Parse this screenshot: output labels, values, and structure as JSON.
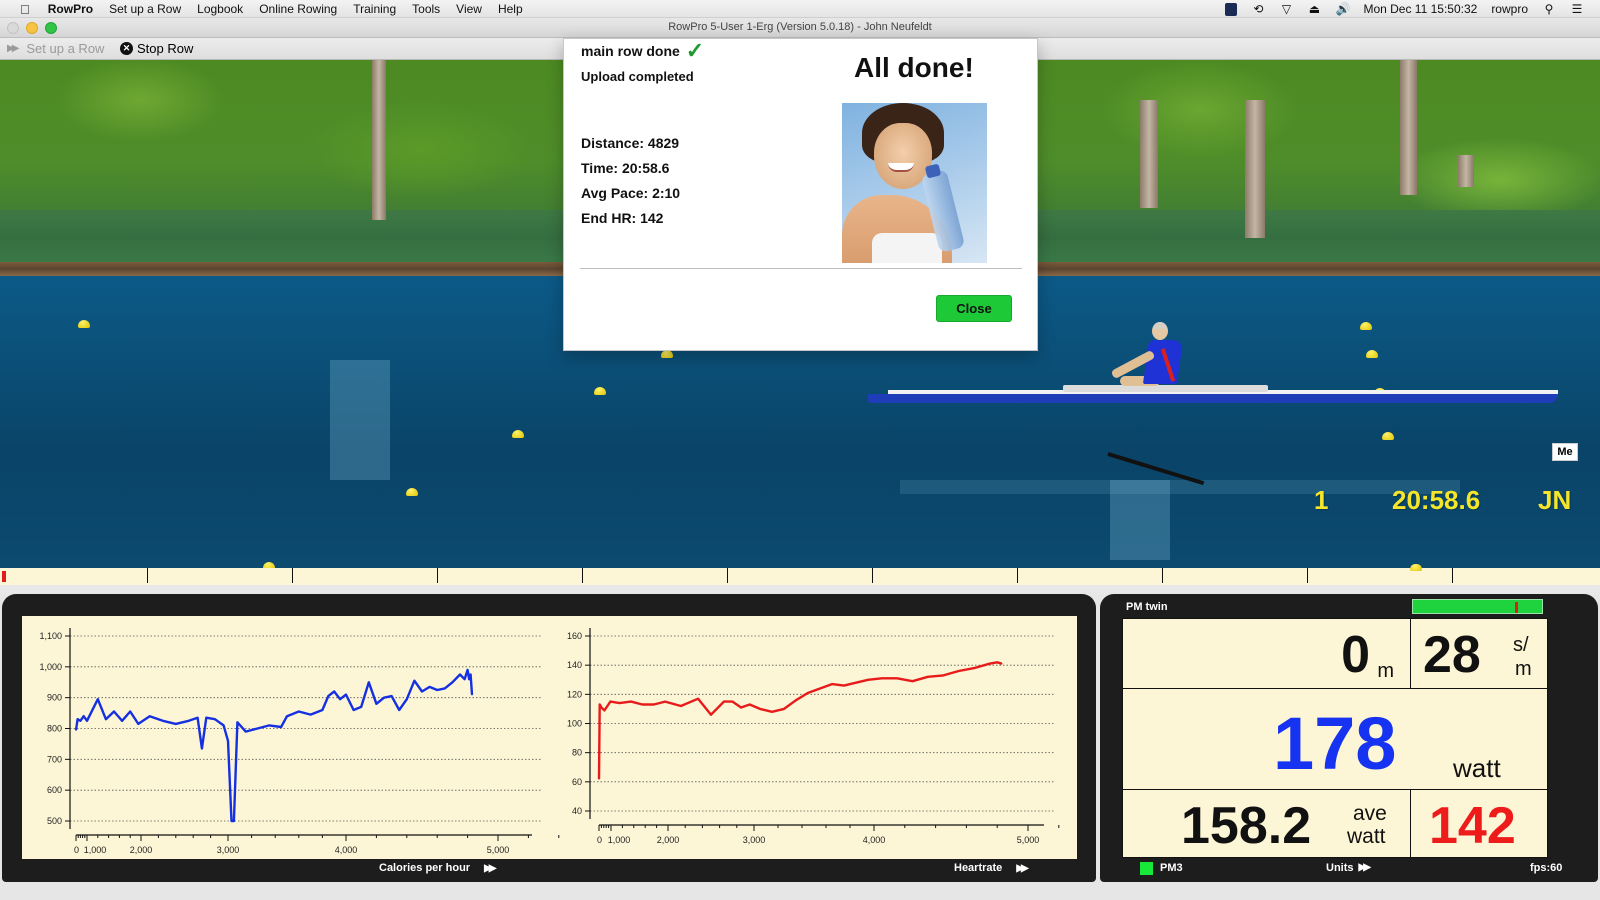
{
  "menubar": {
    "app_name": "RowPro",
    "items": [
      "Set up a Row",
      "Logbook",
      "Online Rowing",
      "Training",
      "Tools",
      "View",
      "Help"
    ],
    "status_icons": [
      "app-status-icon",
      "time-machine-icon",
      "wifi-icon",
      "eject-icon",
      "volume-icon"
    ],
    "clock": "Mon Dec 11  15:50:32",
    "user": "rowpro"
  },
  "window": {
    "title": "RowPro 5-User 1-Erg (Version 5.0.18) - John Neufeldt"
  },
  "toolbar": {
    "setup_label": "Set up a Row",
    "stop_label": "Stop Row"
  },
  "scene": {
    "me_tag": "Me",
    "hud": {
      "position": "1",
      "time": "20:58.6",
      "initials": "JN"
    },
    "colors": {
      "hud": "#f5e629",
      "boat_hull": "#1f3db8"
    }
  },
  "dialog": {
    "status_line1": "main row done",
    "status_line2": "Upload completed",
    "headline": "All done!",
    "stats": [
      "Distance: 4829",
      "Time: 20:58.6",
      "Avg Pace: 2:10",
      "End HR: 142"
    ],
    "close_label": "Close",
    "close_color": "#1ec938"
  },
  "charts_footer": {
    "left_label": "Calories per hour",
    "right_label": "Heartrate"
  },
  "monitor": {
    "title": "PM twin",
    "stroke_rate_bar_fraction": 0.79,
    "distance_value": "0",
    "distance_unit": "m",
    "stroke_rate_value": "28",
    "stroke_rate_unit_top": "s/",
    "stroke_rate_unit_bottom": "m",
    "power_value": "178",
    "power_unit": "watt",
    "avg_power_value": "158.2",
    "avg_power_unit_top": "ave",
    "avg_power_unit_bottom": "watt",
    "heart_rate_value": "142",
    "footer_device": "PM3",
    "footer_units": "Units",
    "footer_fps": "fps:60",
    "colors": {
      "power": "#1533f0",
      "heart_rate": "#ee1b1b",
      "led": "#18e83a"
    }
  },
  "chart_data": [
    {
      "type": "line",
      "title": "Calories per hour",
      "xlabel": "",
      "ylabel": "",
      "ylim": [
        500,
        1100
      ],
      "yticks": [
        500,
        600,
        700,
        800,
        900,
        1000,
        1100
      ],
      "ytick_labels": [
        "500",
        "600",
        "700",
        "800",
        "900",
        "1,000",
        "1,100"
      ],
      "xticks": [
        0,
        1000,
        2000,
        3000,
        4000,
        5000
      ],
      "xtick_labels": [
        "0",
        "1,000",
        "2,000",
        "3,000",
        "4,000",
        "5,000"
      ],
      "grid": true,
      "color": "#1430e0",
      "series": [
        {
          "name": "Calories per hour",
          "x": [
            0,
            150,
            400,
            700,
            1000,
            1200,
            1350,
            1500,
            1650,
            1800,
            1950,
            2100,
            2250,
            2400,
            2550,
            2650,
            2700,
            2750,
            2850,
            2950,
            3000,
            3030,
            3050,
            3080,
            3150,
            3250,
            3350,
            3450,
            3500,
            3600,
            3700,
            3800,
            3850,
            3900,
            3950,
            4000,
            4050,
            4100,
            4150,
            4200,
            4250,
            4300,
            4350,
            4400,
            4450,
            4500,
            4550,
            4600,
            4650,
            4700,
            4750,
            4780,
            4800,
            4810,
            4820,
            4829
          ],
          "y": [
            795,
            830,
            825,
            840,
            825,
            895,
            830,
            855,
            825,
            855,
            815,
            840,
            825,
            815,
            825,
            835,
            735,
            835,
            830,
            810,
            760,
            500,
            500,
            820,
            790,
            800,
            810,
            805,
            840,
            855,
            845,
            860,
            905,
            920,
            895,
            910,
            860,
            870,
            950,
            880,
            900,
            905,
            860,
            895,
            955,
            920,
            935,
            925,
            930,
            950,
            975,
            960,
            990,
            960,
            975,
            910
          ]
        }
      ]
    },
    {
      "type": "line",
      "title": "Heartrate",
      "xlabel": "",
      "ylabel": "",
      "ylim": [
        30,
        160
      ],
      "yticks": [
        40,
        60,
        80,
        100,
        120,
        140,
        160
      ],
      "ytick_labels": [
        "40",
        "60",
        "80",
        "100",
        "120",
        "140",
        "160"
      ],
      "xticks": [
        0,
        1000,
        2000,
        3000,
        4000,
        5000
      ],
      "xtick_labels": [
        "0",
        "1,000",
        "2,000",
        "3,000",
        "4,000",
        "5,000"
      ],
      "grid": true,
      "color": "#e81b1b",
      "series": [
        {
          "name": "Heartrate",
          "x": [
            0,
            60,
            200,
            450,
            700,
            950,
            1150,
            1350,
            1550,
            1750,
            1950,
            2150,
            2350,
            2500,
            2650,
            2750,
            2850,
            2950,
            3050,
            3150,
            3250,
            3350,
            3450,
            3550,
            3650,
            3750,
            3850,
            3950,
            4050,
            4150,
            4250,
            4350,
            4450,
            4550,
            4650,
            4750,
            4800,
            4829
          ],
          "y": [
            62,
            113,
            111,
            109,
            112,
            115,
            114,
            115,
            113,
            113,
            115,
            112,
            117,
            106,
            115,
            115,
            111,
            113,
            110,
            108,
            110,
            116,
            121,
            124,
            127,
            126,
            128,
            130,
            131,
            131,
            129,
            132,
            133,
            136,
            138,
            141,
            142,
            141
          ]
        }
      ]
    }
  ]
}
